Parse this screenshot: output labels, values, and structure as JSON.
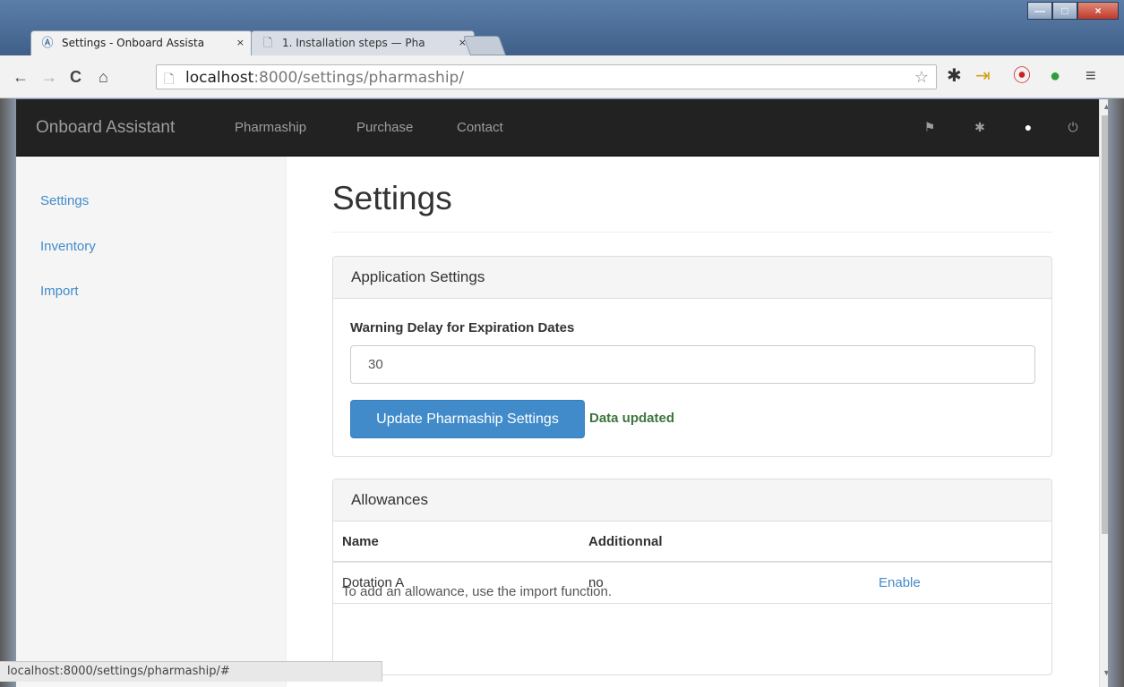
{
  "browser": {
    "tabs": [
      {
        "title": "Settings - Onboard Assista",
        "icon": "onboard-logo-icon",
        "active": true
      },
      {
        "title": "1. Installation steps — Pha",
        "icon": "page-icon",
        "active": false
      }
    ],
    "url": {
      "host": "localhost",
      "path": ":8000/settings/pharmaship/"
    },
    "status_url": "localhost:8000/settings/pharmaship/#",
    "glyphs": {
      "close": "×",
      "back": "←",
      "forward": "→",
      "reload": "C",
      "home": "⌂",
      "page": "🗋",
      "star": "☆",
      "settings": "✱",
      "extension": "⇥",
      "stop": "⦿",
      "leaf": "●",
      "menu": "≡",
      "minimize": "—",
      "maximize": "□",
      "scroll_up": "▲",
      "scroll_down": "▼",
      "onboard_logo": "Ⓐ"
    }
  },
  "navbar": {
    "brand": "Onboard Assistant",
    "links": [
      "Pharmaship",
      "Purchase",
      "Contact"
    ],
    "icons": {
      "flag": "⚑",
      "gear": "✱",
      "user": "●",
      "power": "⏻"
    }
  },
  "sidebar": {
    "items": [
      "Settings",
      "Inventory",
      "Import"
    ]
  },
  "main": {
    "title": "Settings",
    "app_settings": {
      "heading": "Application Settings",
      "label": "Warning Delay for Expiration Dates",
      "value": "30",
      "button": "Update Pharmaship Settings",
      "status": "Data updated"
    },
    "allowances": {
      "heading": "Allowances",
      "columns": [
        "Name",
        "Additionnal"
      ],
      "rows": [
        {
          "name": "Dotation A",
          "additional": "no",
          "action": "Enable"
        }
      ],
      "note": "To add an allowance, use the import function."
    }
  },
  "colors": {
    "navbar_bg": "#222222",
    "link": "#428bca",
    "primary_button": "#428bca",
    "success_text": "#3c763d"
  }
}
